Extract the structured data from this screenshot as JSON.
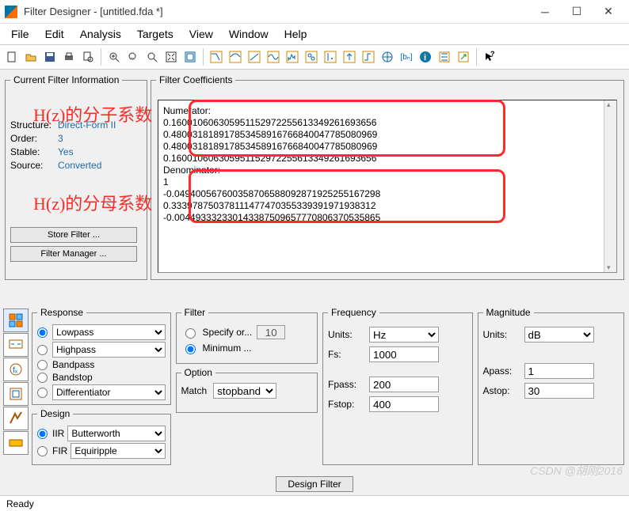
{
  "window": {
    "title": "Filter Designer -  [untitled.fda *]"
  },
  "menu": [
    "File",
    "Edit",
    "Analysis",
    "Targets",
    "View",
    "Window",
    "Help"
  ],
  "toolbar_icons": [
    "new",
    "open",
    "save",
    "print",
    "print-preview",
    "zoom-in",
    "zoom-x",
    "zoom-full",
    "fit",
    "window",
    "mag-response",
    "phase-response",
    "pole-zero",
    "impulse",
    "step",
    "group-delay",
    "phase-delay",
    "up-arrow",
    "freq-trans",
    "polezero-ed",
    "log",
    "info",
    "coeff-view",
    "export",
    "help-pointer"
  ],
  "cfi": {
    "legend": "Current Filter Information",
    "structure_lbl": "Structure:",
    "structure": "Direct-Form II",
    "order_lbl": "Order:",
    "order": "3",
    "stable_lbl": "Stable:",
    "stable": "Yes",
    "source_lbl": "Source:",
    "source": "Converted",
    "store_btn": "Store Filter ...",
    "manager_btn": "Filter Manager ..."
  },
  "coef": {
    "legend": "Filter Coefficients",
    "num_lbl": "Numerator:",
    "num": [
      "0.160010606305951152972255613349261693656",
      "0.480031818917853458916766840047785080969",
      "0.480031818917853458916766840047785080969",
      "0.160010606305951152972255613349261693656"
    ],
    "den_lbl": "Denominator:",
    "den": [
      "1",
      "-0.049400567600358706588092871925255167298",
      "0.333978750378111477470355339391971938312",
      "-0.004493332330143387509657770806370535865"
    ]
  },
  "anno": {
    "num": "H(z)的分子系数",
    "den": "H(z)的分母系数"
  },
  "response": {
    "legend": "Response",
    "lowpass": "Lowpass",
    "highpass": "Highpass",
    "bandpass": "Bandpass",
    "bandstop": "Bandstop",
    "diff": "Differentiator"
  },
  "designfs": {
    "legend": "Design",
    "iir": "IIR",
    "iir_sel": "Butterworth",
    "fir": "FIR",
    "fir_sel": "Equiripple"
  },
  "filterfs": {
    "legend": "Filter",
    "specify": "Specify or...",
    "specify_val": "10",
    "minimum": "Minimum ..."
  },
  "optionfs": {
    "legend": "Option",
    "match": "Match",
    "match_sel": "stopband"
  },
  "freq": {
    "legend": "Frequency",
    "units_lbl": "Units:",
    "units": "Hz",
    "fs_lbl": "Fs:",
    "fs": "1000",
    "fpass_lbl": "Fpass:",
    "fpass": "200",
    "fstop_lbl": "Fstop:",
    "fstop": "400"
  },
  "mag": {
    "legend": "Magnitude",
    "units_lbl": "Units:",
    "units": "dB",
    "apass_lbl": "Apass:",
    "apass": "1",
    "astop_lbl": "Astop:",
    "astop": "30"
  },
  "design_btn": "Design Filter",
  "status": "Ready",
  "watermark": "CSDN @胡刚2016"
}
